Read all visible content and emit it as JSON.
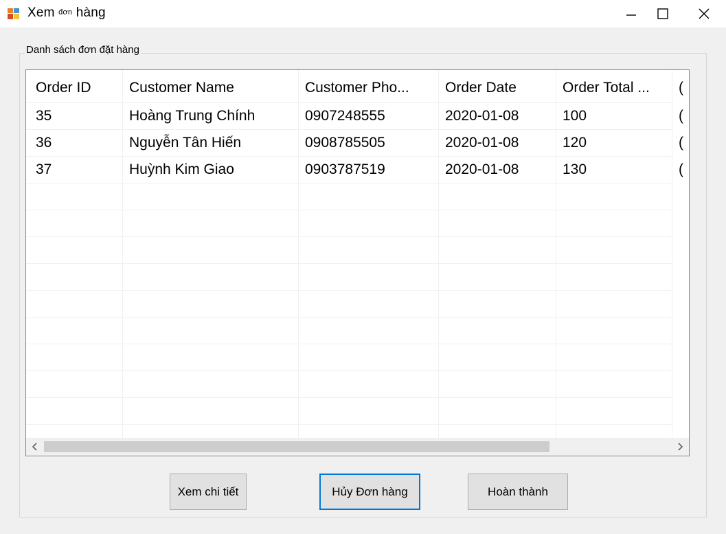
{
  "window": {
    "title_main": "Xem ",
    "title_small": "đơn",
    "title_end": " hàng"
  },
  "group": {
    "title": "Danh sách đơn đặt hàng"
  },
  "grid": {
    "columns": [
      "Order ID",
      "Customer Name",
      "Customer Pho...",
      "Order Date",
      "Order Total ...",
      "("
    ],
    "rows": [
      [
        "35",
        "Hoàng Trung Chính",
        "0907248555",
        "2020-01-08",
        "100",
        "("
      ],
      [
        "36",
        "Nguyễn Tân Hiến",
        "0908785505",
        "2020-01-08",
        "120",
        "("
      ],
      [
        "37",
        "Huỳnh Kim Giao",
        "0903787519",
        "2020-01-08",
        "130",
        "("
      ]
    ]
  },
  "buttons": {
    "view_detail": "Xem chi tiết",
    "cancel_order": "Hủy Đơn hàng",
    "complete": "Hoàn thành"
  },
  "colors": {
    "focus_border": "#0078d7",
    "grid_border": "#828790"
  }
}
